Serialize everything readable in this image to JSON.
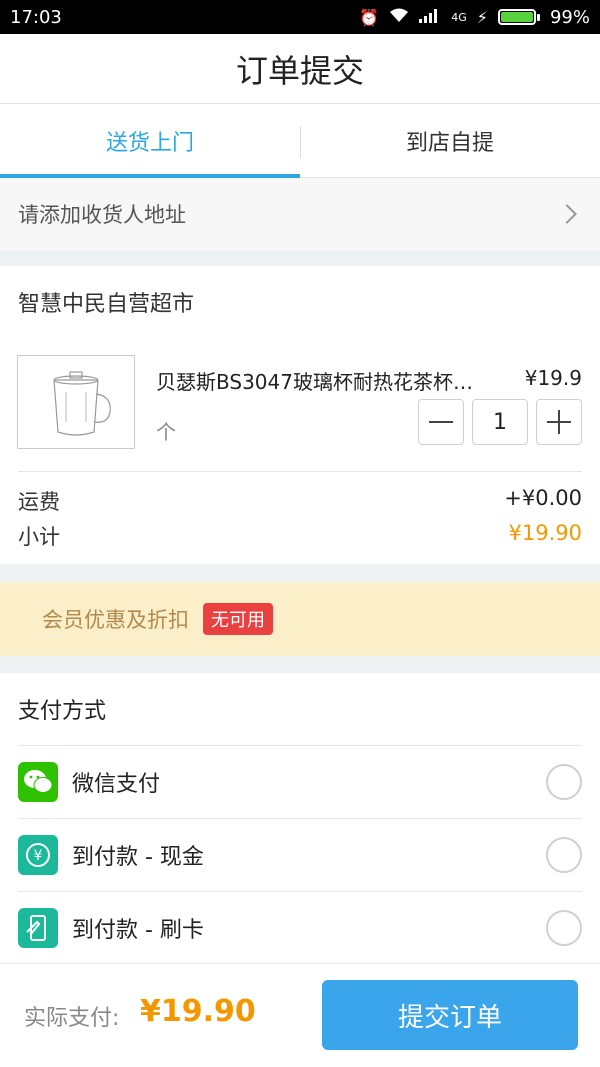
{
  "status": {
    "time": "17:03",
    "network": "4G",
    "battery": "99%",
    "battery_level": 0.99
  },
  "header": {
    "title": "订单提交"
  },
  "tabs": [
    {
      "label": "送货上门",
      "active": true
    },
    {
      "label": "到店自提",
      "active": false
    }
  ],
  "address": {
    "placeholder": "请添加收货人地址"
  },
  "store": {
    "name": "智慧中民自营超市",
    "product": {
      "name": "贝瑟斯BS3047玻璃杯耐热花茶杯…",
      "price": "¥19.9",
      "quantity": "1",
      "unit_icon": "个"
    },
    "shipping_label": "运费",
    "shipping_value": "+¥0.00",
    "subtotal_label": "小计",
    "subtotal_value": "¥19.90"
  },
  "member": {
    "label": "会员优惠及折扣",
    "badge": "无可用"
  },
  "payment": {
    "title": "支付方式",
    "methods": [
      {
        "label": "微信支付",
        "icon": "wechat-icon",
        "color": "#2dc100"
      },
      {
        "label": "到付款 - 现金",
        "icon": "cash-icon",
        "color": "#1bb99a"
      },
      {
        "label": "到付款 - 刷卡",
        "icon": "card-icon",
        "color": "#1bb99a"
      }
    ]
  },
  "bottom": {
    "actual_label": "实际支付:",
    "actual_value": "¥19.90",
    "submit_label": "提交订单"
  },
  "colors": {
    "accent": "#2ea7e0",
    "price": "#f39800",
    "badge": "#e94040",
    "submit": "#3aa5ea"
  }
}
